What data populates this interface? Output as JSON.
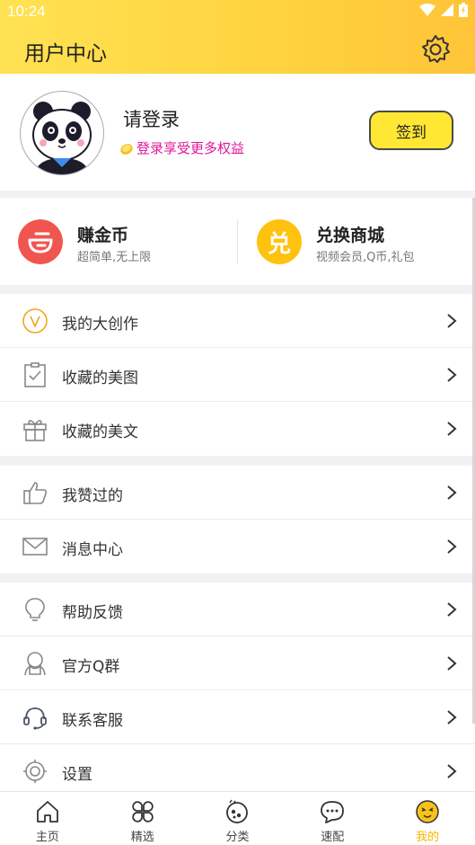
{
  "status_bar": {
    "time": "10:24"
  },
  "header": {
    "title": "用户中心",
    "settings_icon": "gear-icon"
  },
  "profile": {
    "login_title": "请登录",
    "login_sub": "登录享受更多权益",
    "signin_label": "签到"
  },
  "promo": [
    {
      "title": "赚金币",
      "subtitle": "超简单,无上限",
      "icon": "coin-icon",
      "color": "#f1554f"
    },
    {
      "title": "兑换商城",
      "subtitle": "视频会员,Q币,礼包",
      "icon": "exchange-icon",
      "glyph": "兑",
      "color": "#ffc20e"
    }
  ],
  "menu_group_1": [
    {
      "label": "我的大创作",
      "icon": "v-circle-icon"
    },
    {
      "label": "收藏的美图",
      "icon": "clipboard-check-icon"
    },
    {
      "label": "收藏的美文",
      "icon": "gift-icon"
    }
  ],
  "menu_group_2": [
    {
      "label": "我赞过的",
      "icon": "thumbs-up-icon"
    },
    {
      "label": "消息中心",
      "icon": "mail-icon"
    }
  ],
  "menu_group_3": [
    {
      "label": "帮助反馈",
      "icon": "lightbulb-icon"
    },
    {
      "label": "官方Q群",
      "icon": "group-icon"
    },
    {
      "label": "联系客服",
      "icon": "headset-icon"
    },
    {
      "label": "设置",
      "icon": "settings-icon"
    }
  ],
  "tabbar": [
    {
      "label": "主页",
      "icon": "home-icon",
      "active": false
    },
    {
      "label": "精选",
      "icon": "grid-icon",
      "active": false
    },
    {
      "label": "分类",
      "icon": "category-icon",
      "active": false
    },
    {
      "label": "速配",
      "icon": "chat-icon",
      "active": false
    },
    {
      "label": "我的",
      "icon": "face-icon",
      "active": true
    }
  ],
  "colors": {
    "accent": "#ffd23e",
    "active_tab": "#f7b500",
    "pink": "#e0179a"
  }
}
